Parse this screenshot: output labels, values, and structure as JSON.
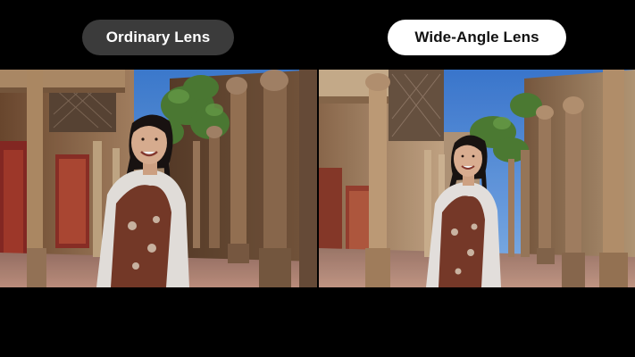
{
  "labels": {
    "ordinary": "Ordinary Lens",
    "wide": "Wide-Angle Lens"
  },
  "colors": {
    "background": "#000000",
    "ordinary_pill": "#3b3b3b",
    "wide_pill": "#ffffff",
    "sky": "#4a86d8",
    "wall": "#c9aa80",
    "door": "#8a2a24",
    "ground": "#b88a74",
    "foliage": "#4f7e35"
  },
  "photos": {
    "ordinary": {
      "scene": "courtyard-colonnade",
      "lens": "ordinary"
    },
    "wide": {
      "scene": "courtyard-colonnade",
      "lens": "wide-angle"
    }
  }
}
